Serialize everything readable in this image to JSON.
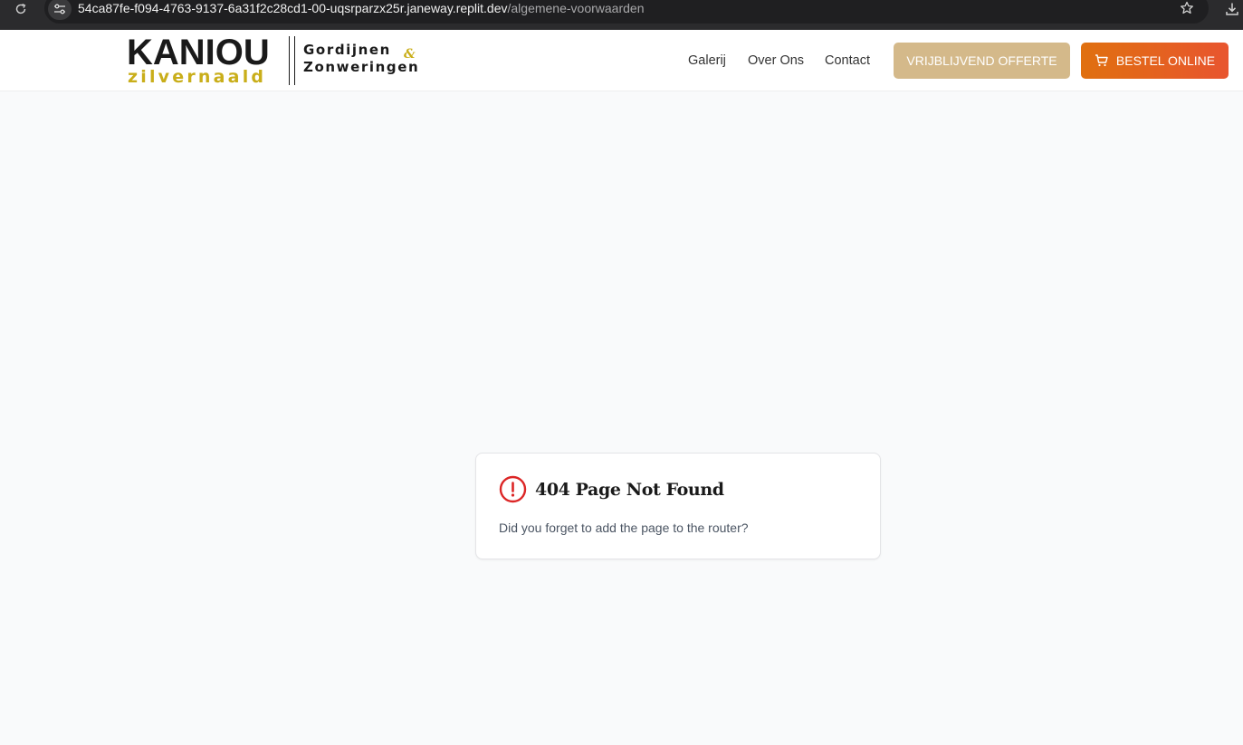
{
  "browser": {
    "url_host": "54ca87fe-f094-4763-9137-6a31f2c28cd1-00-uqsrparzx25r.janeway.replit.dev",
    "url_path": "/algemene-voorwaarden",
    "icons": [
      "reload-icon",
      "site-settings-icon",
      "bookmark-star-icon",
      "download-icon"
    ]
  },
  "header": {
    "logo": {
      "brand": "KANIOU",
      "sub": "zilvernaald",
      "tagline_1": "Gordijnen",
      "ampersand": "&",
      "tagline_2": "Zonweringen"
    },
    "nav": [
      {
        "label": "Galerij"
      },
      {
        "label": "Over Ons"
      },
      {
        "label": "Contact"
      }
    ],
    "cta_offerte": "VRIJBLIJVEND OFFERTE",
    "cta_bestel": "BESTEL ONLINE"
  },
  "colors": {
    "offerte_button": "#d4b98a",
    "bestel_button": "#e8552f",
    "logo_accent": "#c9ae1a",
    "alert_red": "#dc2626"
  },
  "not_found": {
    "title": "404 Page Not Found",
    "message": "Did you forget to add the page to the router?",
    "icon": "alert-circle-icon"
  }
}
